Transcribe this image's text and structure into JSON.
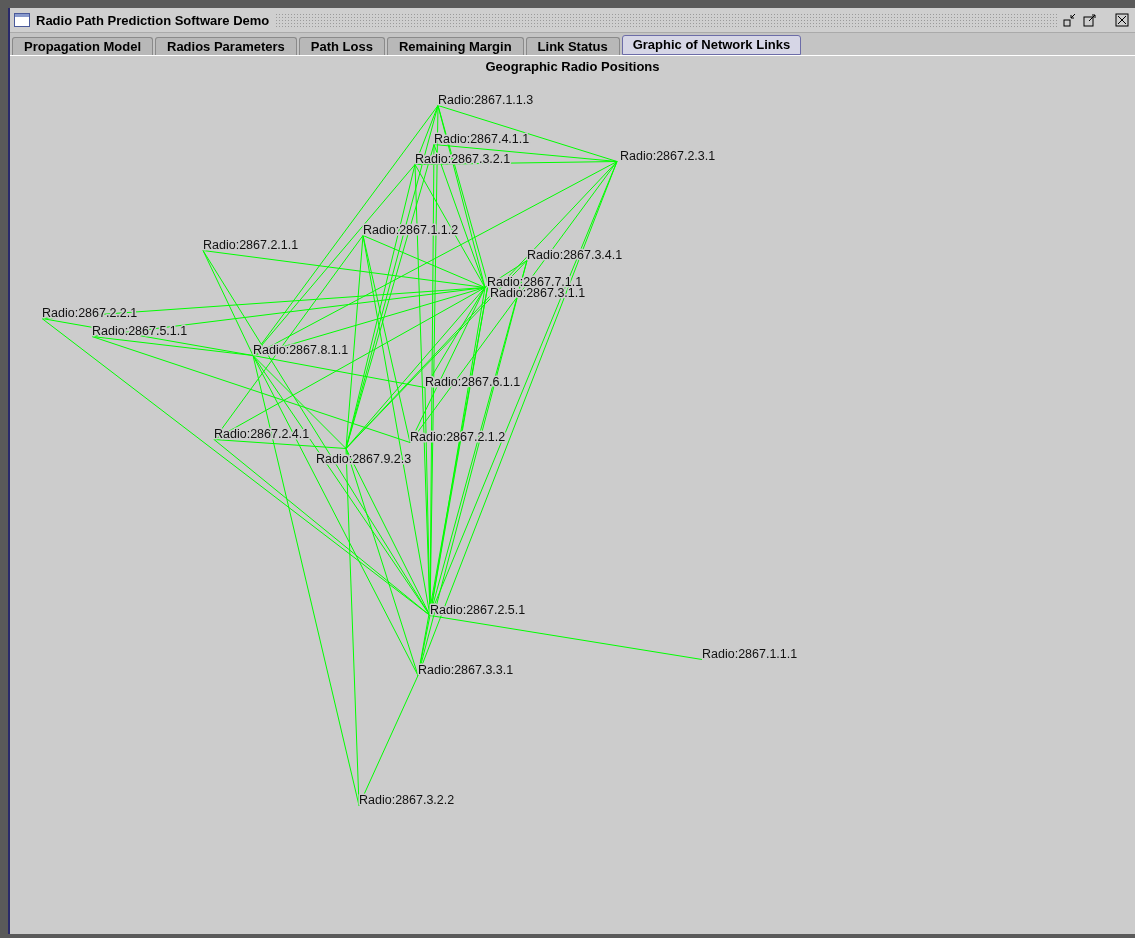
{
  "window": {
    "title": "Radio Path Prediction Software Demo"
  },
  "tabs": [
    {
      "label": "Propagation Model",
      "selected": false
    },
    {
      "label": "Radios Parameters",
      "selected": false
    },
    {
      "label": "Path Loss",
      "selected": false
    },
    {
      "label": "Remaining Margin",
      "selected": false
    },
    {
      "label": "Link Status",
      "selected": false
    },
    {
      "label": "Graphic of Network Links",
      "selected": true
    }
  ],
  "graph": {
    "title": "Geographic Radio Positions",
    "nodes": [
      {
        "label": "Radio:2867.1.1.3"
      },
      {
        "label": "Radio:2867.4.1.1"
      },
      {
        "label": "Radio:2867.3.2.1"
      },
      {
        "label": "Radio:2867.2.3.1"
      },
      {
        "label": "Radio:2867.1.1.2"
      },
      {
        "label": "Radio:2867.2.1.1"
      },
      {
        "label": "Radio:2867.3.4.1"
      },
      {
        "label": "Radio:2867.7.1.1"
      },
      {
        "label": "Radio:2867.3.1.1"
      },
      {
        "label": "Radio:2867.2.2.1"
      },
      {
        "label": "Radio:2867.5.1.1"
      },
      {
        "label": "Radio:2867.8.1.1"
      },
      {
        "label": "Radio:2867.6.1.1"
      },
      {
        "label": "Radio:2867.2.4.1"
      },
      {
        "label": "Radio:2867.9.2.3"
      },
      {
        "label": "Radio:2867.2.1.2"
      },
      {
        "label": "Radio:2867.2.5.1"
      },
      {
        "label": "Radio:2867.1.1.1"
      },
      {
        "label": "Radio:2867.3.3.1"
      },
      {
        "label": "Radio:2867.3.2.2"
      }
    ]
  }
}
